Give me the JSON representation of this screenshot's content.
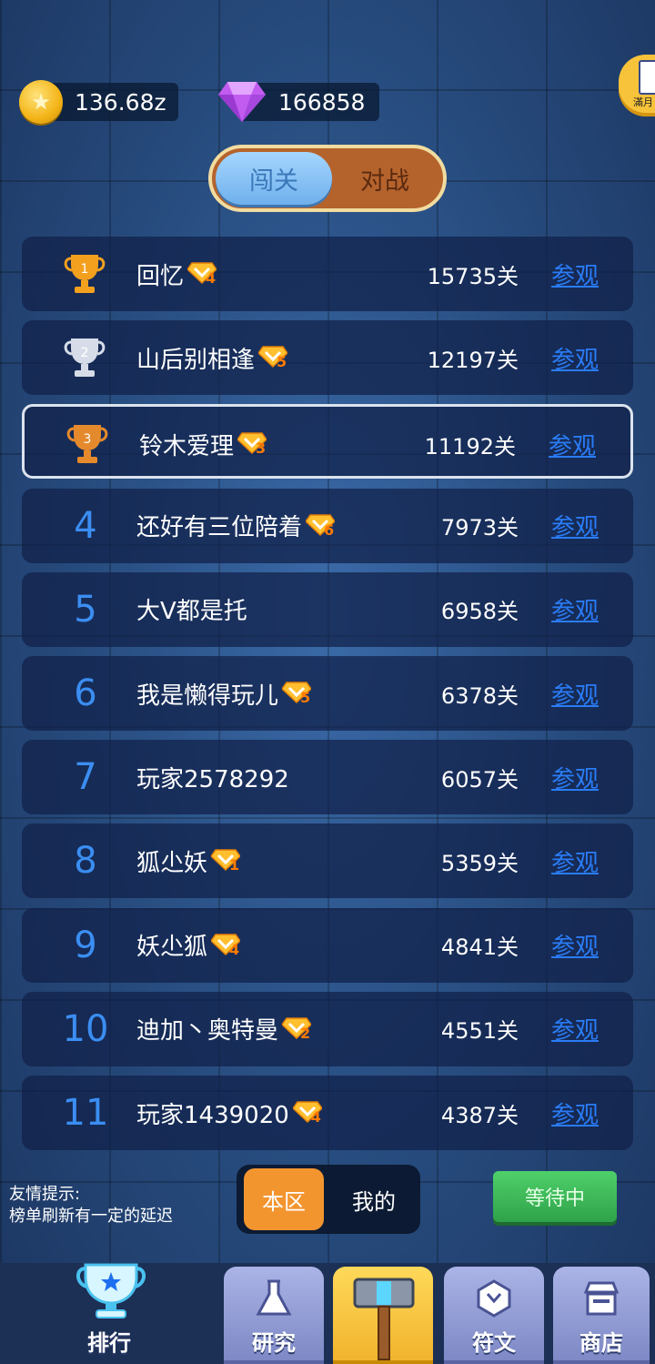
{
  "currency": {
    "coins": "136.68z",
    "gems": "166858"
  },
  "corner_button": {
    "label": "滿月"
  },
  "mode_tabs": {
    "active": "闯关",
    "inactive": "对战"
  },
  "view_label": "参观",
  "rankings": [
    {
      "rank": "1",
      "name": "回忆",
      "vip": "4",
      "score": "15735关",
      "trophy": "gold"
    },
    {
      "rank": "2",
      "name": "山后别相逢",
      "vip": "5",
      "score": "12197关",
      "trophy": "silver"
    },
    {
      "rank": "3",
      "name": "铃木爱理",
      "vip": "3",
      "score": "11192关",
      "trophy": "bronze"
    },
    {
      "rank": "4",
      "name": "还好有三位陪着",
      "vip": "6",
      "score": "7973关"
    },
    {
      "rank": "5",
      "name": "大V都是托",
      "vip": "",
      "score": "6958关"
    },
    {
      "rank": "6",
      "name": "我是懒得玩儿",
      "vip": "5",
      "score": "6378关"
    },
    {
      "rank": "7",
      "name": "玩家2578292",
      "vip": "",
      "score": "6057关"
    },
    {
      "rank": "8",
      "name": "狐尐妖",
      "vip": "1",
      "score": "5359关"
    },
    {
      "rank": "9",
      "name": "妖尐狐",
      "vip": "4",
      "score": "4841关"
    },
    {
      "rank": "10",
      "name": "迪加丶奥特曼",
      "vip": "2",
      "score": "4551关"
    },
    {
      "rank": "11",
      "name": "玩家1439020",
      "vip": "4",
      "score": "4387关"
    }
  ],
  "tip": {
    "line1": "友情提示:",
    "line2": "榜单刷新有一定的延迟"
  },
  "region_tabs": {
    "active": "本区",
    "inactive": "我的"
  },
  "wait_button": "等待中",
  "nav": {
    "ranking": "排行",
    "research": "研究",
    "runes": "符文",
    "shop": "商店"
  },
  "colors": {
    "rank_number": "#3b8ef2",
    "view_link": "#2a7cf6",
    "vip_number": "#ff7a00"
  }
}
